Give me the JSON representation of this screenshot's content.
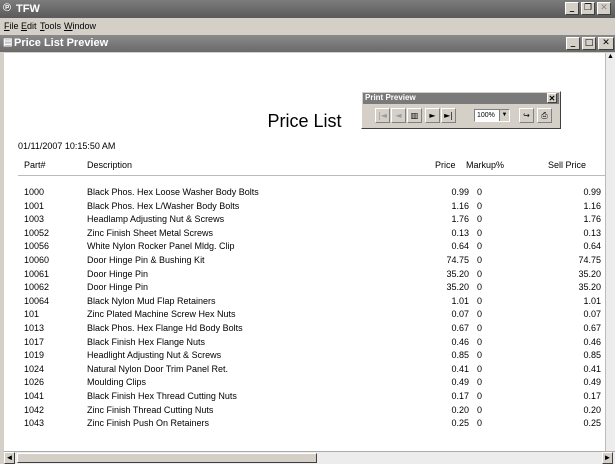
{
  "app": {
    "title": "TFW"
  },
  "menu": [
    "File",
    "Edit",
    "Tools",
    "Window"
  ],
  "child": {
    "title": "Price List Preview"
  },
  "print_preview": {
    "title": "Print Preview",
    "zoom": "100%"
  },
  "report": {
    "title": "Price List",
    "timestamp": "01/11/2007 10:15:50 AM",
    "headers": {
      "part": "Part#",
      "description": "Description",
      "price": "Price",
      "markup": "Markup%",
      "sell": "Sell Price"
    },
    "rows": [
      {
        "part": "1000",
        "description": "Black Phos. Hex Loose Washer Body Bolts",
        "price": "0.99",
        "markup": "0",
        "sell": "0.99"
      },
      {
        "part": "1001",
        "description": "Black Phos. Hex L/Washer Body Bolts",
        "price": "1.16",
        "markup": "0",
        "sell": "1.16"
      },
      {
        "part": "1003",
        "description": "Headlamp Adjusting Nut  & Screws",
        "price": "1.76",
        "markup": "0",
        "sell": "1.76"
      },
      {
        "part": "10052",
        "description": "Zinc Finish Sheet Metal Screws",
        "price": "0.13",
        "markup": "0",
        "sell": "0.13"
      },
      {
        "part": "10056",
        "description": "White Nylon Rocker Panel Mldg. Clip",
        "price": "0.64",
        "markup": "0",
        "sell": "0.64"
      },
      {
        "part": "10060",
        "description": "Door Hinge Pin & Bushing Kit",
        "price": "74.75",
        "markup": "0",
        "sell": "74.75"
      },
      {
        "part": "10061",
        "description": "Door Hinge Pin",
        "price": "35.20",
        "markup": "0",
        "sell": "35.20"
      },
      {
        "part": "10062",
        "description": "Door Hinge Pin",
        "price": "35.20",
        "markup": "0",
        "sell": "35.20"
      },
      {
        "part": "10064",
        "description": "Black Nylon Mud Flap Retainers",
        "price": "1.01",
        "markup": "0",
        "sell": "1.01"
      },
      {
        "part": "101",
        "description": "Zinc Plated Machine Screw Hex Nuts",
        "price": "0.07",
        "markup": "0",
        "sell": "0.07"
      },
      {
        "part": "1013",
        "description": "Black  Phos. Hex Flange Hd Body Bolts",
        "price": "0.67",
        "markup": "0",
        "sell": "0.67"
      },
      {
        "part": "1017",
        "description": "Black Finish Hex Flange Nuts",
        "price": "0.46",
        "markup": "0",
        "sell": "0.46"
      },
      {
        "part": "1019",
        "description": "Headlight Adjusting Nut & Screws",
        "price": "0.85",
        "markup": "0",
        "sell": "0.85"
      },
      {
        "part": "1024",
        "description": "Natural Nylon Door Trim Panel Ret.",
        "price": "0.41",
        "markup": "0",
        "sell": "0.41"
      },
      {
        "part": "1026",
        "description": "Moulding Clips",
        "price": "0.49",
        "markup": "0",
        "sell": "0.49"
      },
      {
        "part": "1041",
        "description": "Black Finish Hex Thread Cutting Nuts",
        "price": "0.17",
        "markup": "0",
        "sell": "0.17"
      },
      {
        "part": "1042",
        "description": "Zinc Finish Thread Cutting Nuts",
        "price": "0.20",
        "markup": "0",
        "sell": "0.20"
      },
      {
        "part": "1043",
        "description": "Zinc Finish Push On Retainers",
        "price": "0.25",
        "markup": "0",
        "sell": "0.25"
      }
    ]
  }
}
